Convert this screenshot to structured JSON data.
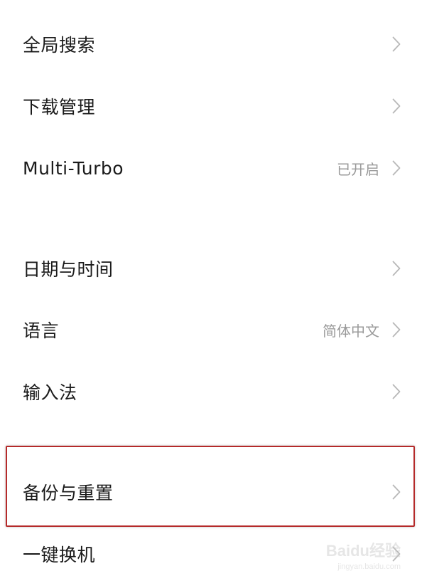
{
  "settings": {
    "items": [
      {
        "label": "全局搜索",
        "value": ""
      },
      {
        "label": "下载管理",
        "value": ""
      },
      {
        "label": "Multi-Turbo",
        "value": "已开启"
      },
      {
        "label": "日期与时间",
        "value": ""
      },
      {
        "label": "语言",
        "value": "简体中文"
      },
      {
        "label": "输入法",
        "value": ""
      },
      {
        "label": "备份与重置",
        "value": ""
      },
      {
        "label": "一键换机",
        "value": ""
      }
    ],
    "highlighted_item": "备份与重置"
  },
  "watermark": {
    "brand": "Baidu经验",
    "url": "jingyan.baidu.com"
  },
  "colors": {
    "label_text": "#1a1a1a",
    "value_text": "#9a9a9a",
    "chevron": "#b8b8b8",
    "highlight_border": "#b52a2a",
    "background": "#ffffff"
  },
  "icons": {
    "row_trailing": "chevron-right-icon"
  }
}
